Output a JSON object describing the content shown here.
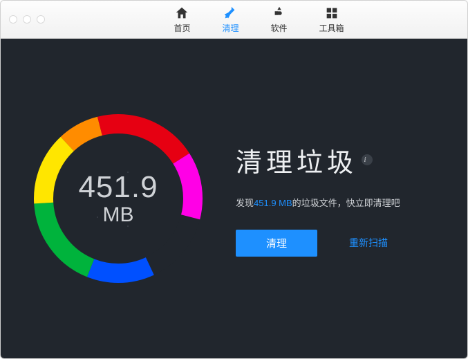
{
  "nav": {
    "items": [
      {
        "label": "首页"
      },
      {
        "label": "清理"
      },
      {
        "label": "软件"
      },
      {
        "label": "工具箱"
      }
    ],
    "active_index": 1
  },
  "gauge": {
    "value": "451.9",
    "unit": "MB",
    "segments": [
      {
        "color": "#ff8c00",
        "fraction": 0.08
      },
      {
        "color": "#e60012",
        "fraction": 0.2
      },
      {
        "color": "#ff00e6",
        "fraction": 0.13
      },
      {
        "color": "#21262d",
        "fraction": 0.14
      },
      {
        "color": "#0050ff",
        "fraction": 0.13
      },
      {
        "color": "#00b33c",
        "fraction": 0.18
      },
      {
        "color": "#ffe600",
        "fraction": 0.14
      }
    ]
  },
  "panel": {
    "heading": "清理垃圾",
    "sub_prefix": "发现",
    "sub_size": "451.9 MB",
    "sub_suffix": "的垃圾文件，快立即清理吧",
    "clean_button": "清理",
    "rescan_link": "重新扫描"
  },
  "chart_data": {
    "type": "pie",
    "title": "清理垃圾",
    "total_label": "451.9 MB",
    "series": [
      {
        "name": "orange",
        "value": 0.08,
        "color": "#ff8c00"
      },
      {
        "name": "red",
        "value": 0.2,
        "color": "#e60012"
      },
      {
        "name": "magenta",
        "value": 0.13,
        "color": "#ff00e6"
      },
      {
        "name": "gap",
        "value": 0.14,
        "color": "#21262d"
      },
      {
        "name": "blue",
        "value": 0.13,
        "color": "#0050ff"
      },
      {
        "name": "green",
        "value": 0.18,
        "color": "#00b33c"
      },
      {
        "name": "yellow",
        "value": 0.14,
        "color": "#ffe600"
      }
    ]
  }
}
